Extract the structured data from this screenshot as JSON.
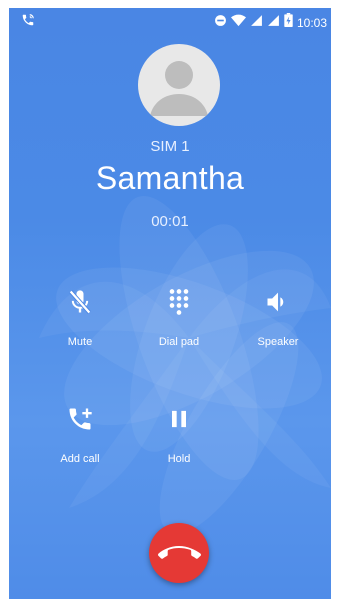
{
  "status_bar": {
    "time": "10:03",
    "icons": [
      "call-icon",
      "do-not-disturb-icon",
      "wifi-icon",
      "signal-icon",
      "signal-icon",
      "battery-charging-icon"
    ]
  },
  "call": {
    "sim_label": "SIM 1",
    "contact_name": "Samantha",
    "duration": "00:01"
  },
  "controls": {
    "mute_label": "Mute",
    "dialpad_label": "Dial pad",
    "speaker_label": "Speaker",
    "add_call_label": "Add call",
    "hold_label": "Hold"
  },
  "colors": {
    "background": "#4a86e4",
    "end_call": "#e53935"
  }
}
